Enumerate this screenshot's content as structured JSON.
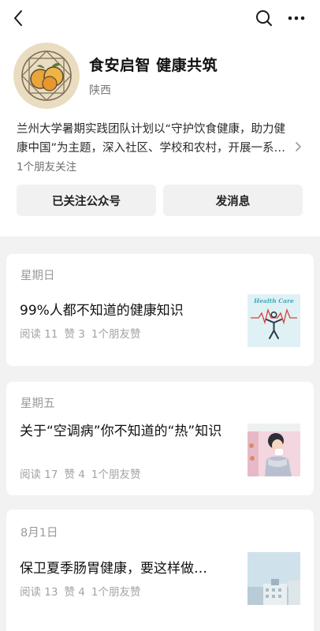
{
  "header": {
    "back_icon": "chevron-left-icon",
    "search_icon": "search-icon",
    "more_icon": "more-horizontal-icon"
  },
  "profile": {
    "name": "食安启智 健康共筑",
    "region": "陕西",
    "description": "兰州大学暑期实践团队计划以“守护饮食健康，助力健康中国”为主题，深入社区、学校和农村，开展一系…",
    "friends_following": "1个朋友关注"
  },
  "actions": {
    "followed_label": "已关注公众号",
    "message_label": "发消息"
  },
  "articles": [
    {
      "date": "星期日",
      "title": "99%人都不知道的健康知识",
      "reads": "阅读 11",
      "likes": "赞 3",
      "friends": "1个朋友赞",
      "thumb_text": "Health Care"
    },
    {
      "date": "星期五",
      "title": "关于“空调病”你不知道的“热”知识",
      "reads": "阅读 17",
      "likes": "赞 4",
      "friends": "1个朋友赞"
    },
    {
      "date": "8月1日",
      "title": "保卫夏季肠胃健康，要这样做…",
      "reads": "阅读 13",
      "likes": "赞 4",
      "friends": "1个朋友赞"
    }
  ],
  "colors": {
    "page_background": "#f2f2f2",
    "card_background": "#ffffff",
    "button_background": "#f1f1f1",
    "secondary_text": "#9a9a9a"
  }
}
